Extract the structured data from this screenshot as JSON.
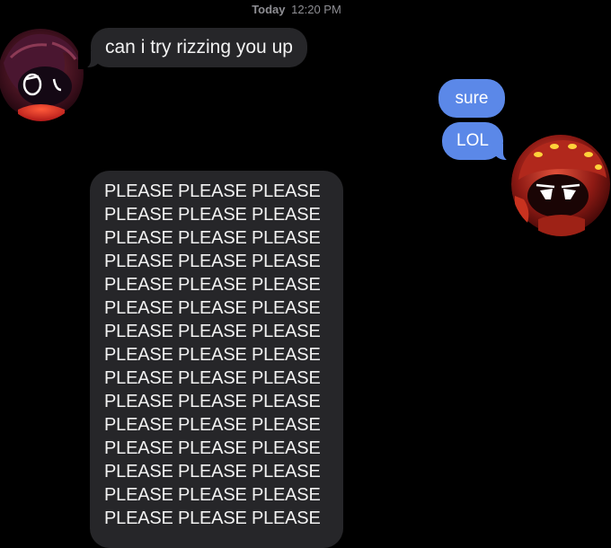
{
  "header": {
    "day": "Today",
    "time": "12:20 PM"
  },
  "messages": [
    {
      "direction": "incoming",
      "text": "can i try rizzing you up"
    },
    {
      "direction": "outgoing",
      "text": "sure"
    },
    {
      "direction": "outgoing",
      "text": "LOL"
    },
    {
      "direction": "incoming",
      "lines": [
        "PLEASE PLEASE PLEASE",
        "PLEASE PLEASE PLEASE",
        "PLEASE PLEASE PLEASE",
        "PLEASE PLEASE PLEASE",
        "PLEASE PLEASE PLEASE",
        "PLEASE PLEASE PLEASE",
        "PLEASE PLEASE PLEASE",
        "PLEASE PLEASE PLEASE",
        "PLEASE PLEASE PLEASE",
        "PLEASE PLEASE PLEASE",
        "PLEASE PLEASE PLEASE",
        "PLEASE PLEASE PLEASE",
        "PLEASE PLEASE PLEASE",
        "PLEASE PLEASE PLEASE",
        "PLEASE PLEASE PLEASE"
      ]
    }
  ],
  "avatars": {
    "left": "purple-haired-character-avatar",
    "right": "red-robot-character-avatar"
  },
  "colors": {
    "background": "#000000",
    "incoming_bubble": "#262629",
    "outgoing_bubble": "#5b88e8",
    "timestamp": "#8e8e93"
  }
}
